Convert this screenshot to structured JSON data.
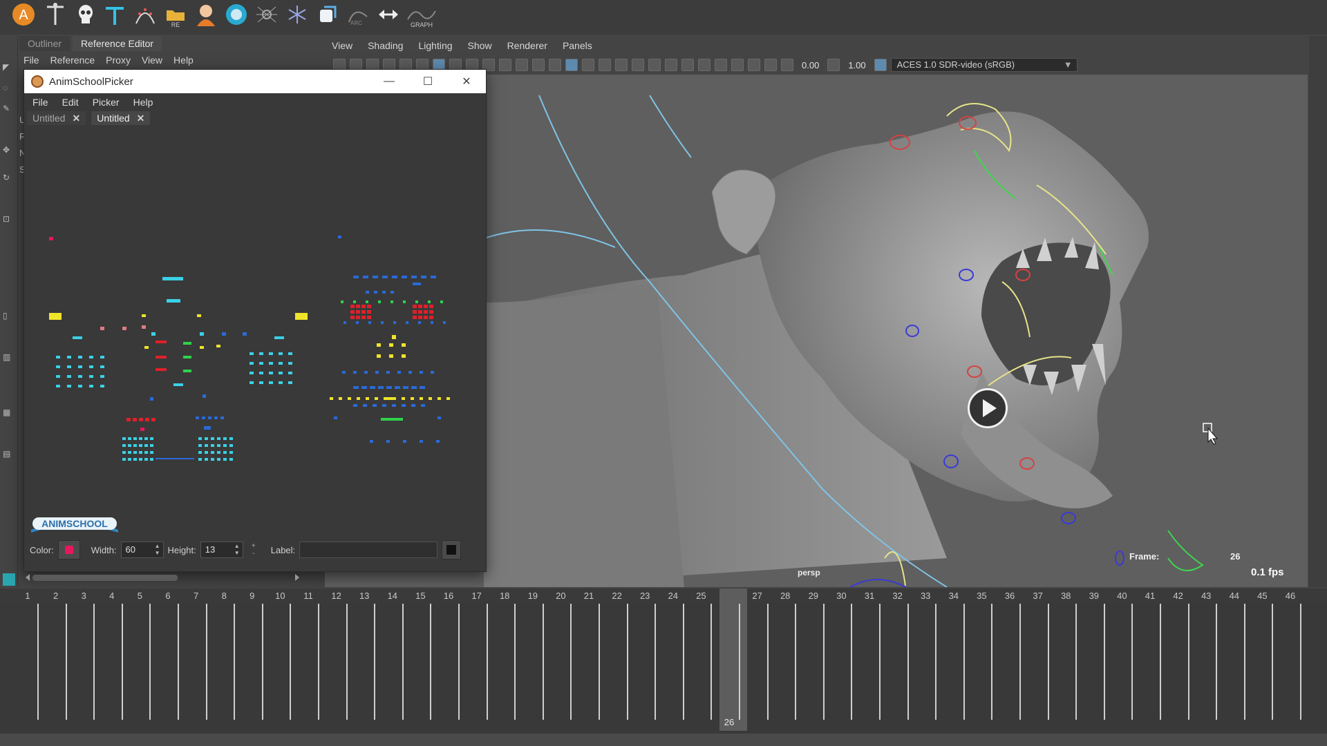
{
  "shelf": {
    "icons": [
      "a-letter-icon",
      "t-pose-icon",
      "skull-icon",
      "joint-t-icon",
      "arc-icon",
      "folder-re-icon",
      "character-icon",
      "ring-icon",
      "spider-icon",
      "asterisk-icon",
      "cube-icon",
      "arc-curve-icon",
      "double-arrow-icon",
      "graph-icon"
    ],
    "re_label": "RE",
    "graph_label": "GRAPH"
  },
  "left_panel": {
    "tabs": [
      "Outliner",
      "Reference Editor"
    ],
    "active_tab": "Reference Editor",
    "menu": [
      "File",
      "Reference",
      "Proxy",
      "View",
      "Help"
    ],
    "side_letters": [
      "U",
      "R",
      "N",
      "S"
    ]
  },
  "viewport": {
    "menu": [
      "View",
      "Shading",
      "Lighting",
      "Show",
      "Renderer",
      "Panels"
    ],
    "exposure": "0.00",
    "gamma": "1.00",
    "colorspace": "ACES 1.0 SDR-video (sRGB)",
    "camera": "persp",
    "frame_label": "Frame:",
    "frame_value": "26",
    "fps": "0.1 fps"
  },
  "picker": {
    "title": "AnimSchoolPicker",
    "menu": [
      "File",
      "Edit",
      "Picker",
      "Help"
    ],
    "tabs": [
      {
        "label": "Untitled",
        "active": false
      },
      {
        "label": "Untitled",
        "active": true
      }
    ],
    "logo_text": "ANIMSCHOOL",
    "color_label": "Color:",
    "color_value": "#e8175d",
    "width_label": "Width:",
    "width_value": "60",
    "height_label": "Height:",
    "height_value": "13",
    "label_label": "Label:",
    "label_value": ""
  },
  "timeline": {
    "ticks": [
      "1",
      "2",
      "3",
      "4",
      "5",
      "6",
      "7",
      "8",
      "9",
      "10",
      "11",
      "12",
      "13",
      "14",
      "15",
      "16",
      "17",
      "18",
      "19",
      "20",
      "21",
      "22",
      "23",
      "24",
      "25",
      "26",
      "27",
      "28",
      "29",
      "30",
      "31",
      "32",
      "33",
      "34",
      "35",
      "36",
      "37",
      "38",
      "39",
      "40",
      "41",
      "42",
      "43",
      "44",
      "45",
      "46"
    ],
    "current_frame": "26"
  },
  "colors": {
    "cyan": "#3ad1e6",
    "yellow": "#f0e42a",
    "red": "#e0202a",
    "green": "#2fd24a",
    "blue": "#2a6ad9",
    "pink": "#e8175d",
    "rose": "#e07b86"
  }
}
